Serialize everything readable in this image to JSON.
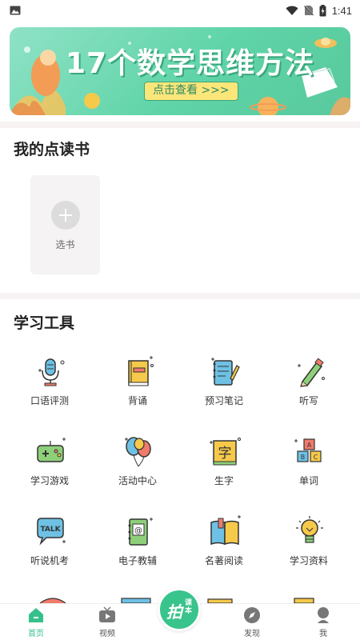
{
  "status_bar": {
    "time": "1:41",
    "icons": [
      "image-icon",
      "wifi-icon",
      "no-sim-icon",
      "battery-charging-icon"
    ]
  },
  "banner": {
    "title": "17个数学思维方法",
    "cta": "点击查看 >>>",
    "dots": 4,
    "active_dot": 0
  },
  "my_books": {
    "title": "我的点读书",
    "add_label": "选书"
  },
  "tools": {
    "title": "学习工具",
    "items": [
      {
        "label": "口语评测",
        "icon": "microphone-icon"
      },
      {
        "label": "背诵",
        "icon": "book-icon"
      },
      {
        "label": "预习笔记",
        "icon": "notebook-icon"
      },
      {
        "label": "听写",
        "icon": "pencil-icon"
      },
      {
        "label": "学习游戏",
        "icon": "gamepad-icon"
      },
      {
        "label": "活动中心",
        "icon": "balloons-icon"
      },
      {
        "label": "生字",
        "icon": "character-card-icon"
      },
      {
        "label": "单词",
        "icon": "letter-blocks-icon"
      },
      {
        "label": "听说机考",
        "icon": "talk-bubble-icon"
      },
      {
        "label": "电子教辅",
        "icon": "ebook-icon"
      },
      {
        "label": "名著阅读",
        "icon": "open-book-icon"
      },
      {
        "label": "学习资料",
        "icon": "lightbulb-icon"
      }
    ]
  },
  "bottom_nav": {
    "items": [
      {
        "label": "首页",
        "icon": "home-icon",
        "active": true
      },
      {
        "label": "视频",
        "icon": "tv-icon",
        "active": false
      },
      {
        "label": "发现",
        "icon": "compass-icon",
        "active": false
      },
      {
        "label": "我",
        "icon": "user-icon",
        "active": false
      }
    ],
    "center": {
      "main": "拍",
      "sub": "课本"
    }
  },
  "colors": {
    "accent": "#36c08b",
    "banner_bg": "#5fd4a8",
    "cta_bg": "#fbe67a",
    "divider": "#f7f3f3"
  }
}
